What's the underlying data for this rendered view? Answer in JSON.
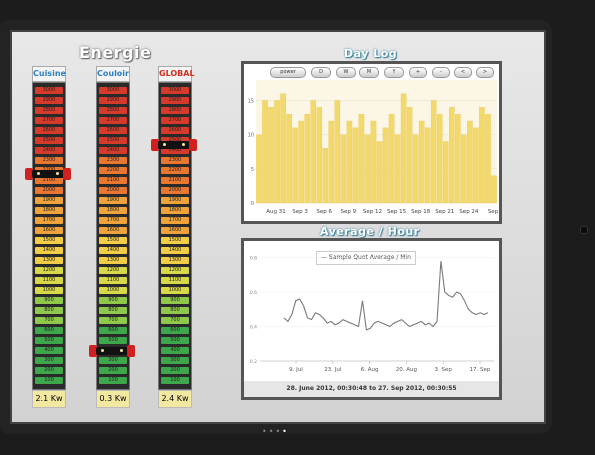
{
  "app_title": "Energie",
  "meters": [
    {
      "label": "Cuisine",
      "label_color": "#2b7fc4",
      "value": "2.1 Kw",
      "level": 2.1
    },
    {
      "label": "Couloir",
      "label_color": "#2b7fc4",
      "value": "0.3 Kw",
      "level": 0.3
    },
    {
      "label": "GLOBAL",
      "label_color": "#d03020",
      "value": "2.4 Kw",
      "level": 2.4
    }
  ],
  "meter_scale": [
    "3000",
    "2900",
    "2800",
    "2700",
    "2600",
    "2500",
    "2400",
    "2300",
    "2200",
    "2100",
    "2000",
    "1900",
    "1800",
    "1700",
    "1600",
    "1500",
    "1400",
    "1300",
    "1200",
    "1100",
    "1000",
    "900",
    "800",
    "700",
    "600",
    "500",
    "400",
    "300",
    "200",
    "100"
  ],
  "day_log": {
    "title": "Day Log",
    "buttons": [
      "power",
      "D",
      "W",
      "M",
      "Y",
      "+",
      "-",
      "<",
      ">"
    ]
  },
  "average": {
    "title": "Average / Hour",
    "legend": "Sample Quot Average / Min",
    "date_range": "28. June 2012, 00:30:48 to 27. Sep 2012, 00:30:55"
  },
  "chart_data": [
    {
      "type": "bar",
      "title": "Day Log",
      "x_ticks": [
        "Aug 31",
        "Sep 3",
        "Sep 6",
        "Sep 9",
        "Sep 12",
        "Sep 15",
        "Sep 18",
        "Sep 21",
        "Sep 24",
        "Sep"
      ],
      "y_ticks": [
        "0",
        "5",
        "10",
        "15"
      ],
      "ylim": [
        0,
        18
      ],
      "values": [
        10,
        15,
        14,
        15,
        16,
        13,
        11,
        12,
        13,
        15,
        14,
        8,
        12,
        15,
        10,
        12,
        11,
        13,
        10,
        12,
        9,
        11,
        13,
        10,
        16,
        14,
        10,
        12,
        11,
        15,
        13,
        9,
        14,
        13,
        10,
        12,
        11,
        14,
        13,
        4
      ],
      "color": "#f3d86a"
    },
    {
      "type": "line",
      "title": "Average / Hour",
      "x_ticks": [
        "9. Jul",
        "23. Jul",
        "6. Aug",
        "20. Aug",
        "3. Sep",
        "17. Sep"
      ],
      "y_ticks": [
        "0.2",
        "0.4",
        "0.6",
        "0.8"
      ],
      "ylim": [
        0.2,
        0.85
      ],
      "series": [
        {
          "name": "Sample Quot Average / Min",
          "values": [
            0.45,
            0.43,
            0.47,
            0.55,
            0.56,
            0.52,
            0.45,
            0.44,
            0.48,
            0.47,
            0.45,
            0.42,
            0.43,
            0.41,
            0.42,
            0.44,
            0.43,
            0.42,
            0.41,
            0.4,
            0.55,
            0.38,
            0.39,
            0.42,
            0.43,
            0.42,
            0.41,
            0.4,
            0.42,
            0.43,
            0.44,
            0.42,
            0.4,
            0.41,
            0.42,
            0.43,
            0.41,
            0.42,
            0.4,
            0.43,
            0.78,
            0.6,
            0.58,
            0.57,
            0.6,
            0.59,
            0.55,
            0.5,
            0.48,
            0.47,
            0.48,
            0.47,
            0.48
          ]
        }
      ]
    }
  ]
}
